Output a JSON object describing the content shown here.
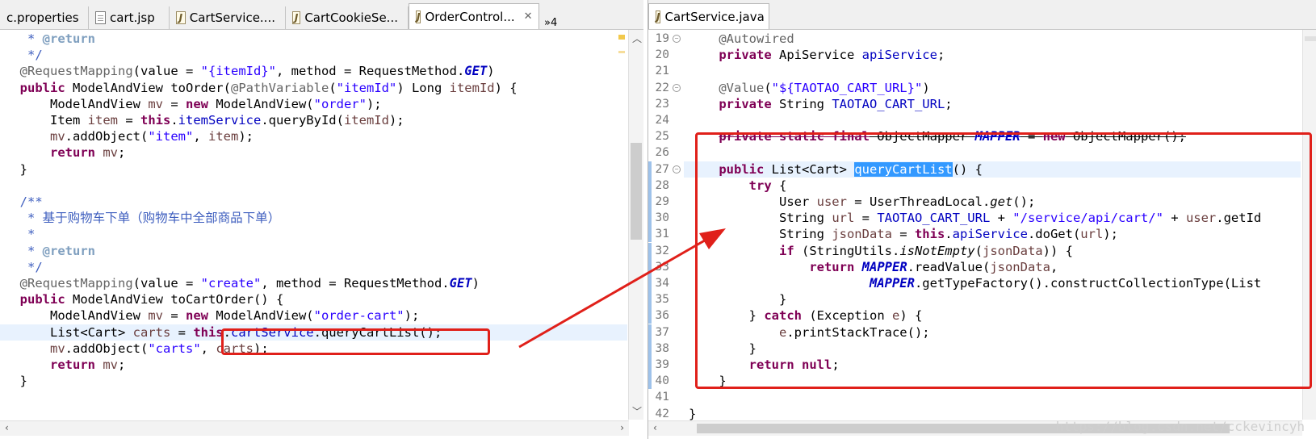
{
  "left_editor": {
    "tabs": [
      {
        "label": "c.properties",
        "icon": "properties-file-icon",
        "active": false
      },
      {
        "label": "cart.jsp",
        "icon": "jsp-file-icon",
        "active": false
      },
      {
        "label": "CartService....",
        "icon": "java-file-icon",
        "active": false
      },
      {
        "label": "CartCookieSe...",
        "icon": "java-file-icon",
        "active": false
      },
      {
        "label": "OrderControl...",
        "icon": "java-file-icon",
        "active": true
      }
    ],
    "overflow_label": "»4",
    "close_glyph": "✕",
    "lines": [
      [
        {
          "t": "   * ",
          "c": "cm"
        },
        {
          "t": "@return",
          "c": "tag"
        }
      ],
      [
        {
          "t": "   */",
          "c": "cm"
        }
      ],
      [
        {
          "t": "  ",
          "c": ""
        },
        {
          "t": "@RequestMapping",
          "c": "ann"
        },
        {
          "t": "(value = ",
          "c": ""
        },
        {
          "t": "\"{itemId}\"",
          "c": "str"
        },
        {
          "t": ", method = RequestMethod.",
          "c": ""
        },
        {
          "t": "GET",
          "c": "sfld"
        },
        {
          "t": ")",
          "c": ""
        }
      ],
      [
        {
          "t": "  ",
          "c": ""
        },
        {
          "t": "public",
          "c": "kw"
        },
        {
          "t": " ModelAndView toOrder(",
          "c": ""
        },
        {
          "t": "@PathVariable",
          "c": "ann"
        },
        {
          "t": "(",
          "c": ""
        },
        {
          "t": "\"itemId\"",
          "c": "str"
        },
        {
          "t": ") Long ",
          "c": ""
        },
        {
          "t": "itemId",
          "c": "var"
        },
        {
          "t": ") {",
          "c": ""
        }
      ],
      [
        {
          "t": "      ModelAndView ",
          "c": ""
        },
        {
          "t": "mv",
          "c": "var"
        },
        {
          "t": " = ",
          "c": ""
        },
        {
          "t": "new",
          "c": "kw"
        },
        {
          "t": " ModelAndView(",
          "c": ""
        },
        {
          "t": "\"order\"",
          "c": "str"
        },
        {
          "t": ");",
          "c": ""
        }
      ],
      [
        {
          "t": "      Item ",
          "c": ""
        },
        {
          "t": "item",
          "c": "var"
        },
        {
          "t": " = ",
          "c": ""
        },
        {
          "t": "this",
          "c": "kw"
        },
        {
          "t": ".",
          "c": ""
        },
        {
          "t": "itemService",
          "c": "fld"
        },
        {
          "t": ".queryById(",
          "c": ""
        },
        {
          "t": "itemId",
          "c": "var"
        },
        {
          "t": ");",
          "c": ""
        }
      ],
      [
        {
          "t": "      ",
          "c": ""
        },
        {
          "t": "mv",
          "c": "var"
        },
        {
          "t": ".addObject(",
          "c": ""
        },
        {
          "t": "\"item\"",
          "c": "str"
        },
        {
          "t": ", ",
          "c": ""
        },
        {
          "t": "item",
          "c": "var"
        },
        {
          "t": ");",
          "c": ""
        }
      ],
      [
        {
          "t": "      ",
          "c": ""
        },
        {
          "t": "return",
          "c": "kw"
        },
        {
          "t": " ",
          "c": ""
        },
        {
          "t": "mv",
          "c": "var"
        },
        {
          "t": ";",
          "c": ""
        }
      ],
      [
        {
          "t": "  }",
          "c": ""
        }
      ],
      [
        {
          "t": "",
          "c": ""
        }
      ],
      [
        {
          "t": "  /**",
          "c": "cm"
        }
      ],
      [
        {
          "t": "   * 基于购物车下单（购物车中全部商品下单）",
          "c": "cm"
        }
      ],
      [
        {
          "t": "   *",
          "c": "cm"
        }
      ],
      [
        {
          "t": "   * ",
          "c": "cm"
        },
        {
          "t": "@return",
          "c": "tag"
        }
      ],
      [
        {
          "t": "   */",
          "c": "cm"
        }
      ],
      [
        {
          "t": "  ",
          "c": ""
        },
        {
          "t": "@RequestMapping",
          "c": "ann"
        },
        {
          "t": "(value = ",
          "c": ""
        },
        {
          "t": "\"create\"",
          "c": "str"
        },
        {
          "t": ", method = RequestMethod.",
          "c": ""
        },
        {
          "t": "GET",
          "c": "sfld"
        },
        {
          "t": ")",
          "c": ""
        }
      ],
      [
        {
          "t": "  ",
          "c": ""
        },
        {
          "t": "public",
          "c": "kw"
        },
        {
          "t": " ModelAndView toCartOrder() {",
          "c": ""
        }
      ],
      [
        {
          "t": "      ModelAndView ",
          "c": ""
        },
        {
          "t": "mv",
          "c": "var"
        },
        {
          "t": " = ",
          "c": ""
        },
        {
          "t": "new",
          "c": "kw"
        },
        {
          "t": " ModelAndView(",
          "c": ""
        },
        {
          "t": "\"order-cart\"",
          "c": "str"
        },
        {
          "t": ");",
          "c": ""
        }
      ],
      [
        {
          "t": "      List<Cart> ",
          "c": ""
        },
        {
          "t": "carts",
          "c": "var"
        },
        {
          "t": " = ",
          "c": ""
        },
        {
          "t": "this",
          "c": "kw"
        },
        {
          "t": ".",
          "c": ""
        },
        {
          "t": "cartService",
          "c": "fld"
        },
        {
          "t": ".queryCartList();",
          "c": ""
        }
      ],
      [
        {
          "t": "      ",
          "c": ""
        },
        {
          "t": "mv",
          "c": "var"
        },
        {
          "t": ".addObject(",
          "c": ""
        },
        {
          "t": "\"carts\"",
          "c": "str"
        },
        {
          "t": ", ",
          "c": ""
        },
        {
          "t": "carts",
          "c": "var"
        },
        {
          "t": ");",
          "c": ""
        }
      ],
      [
        {
          "t": "      ",
          "c": ""
        },
        {
          "t": "return",
          "c": "kw"
        },
        {
          "t": " ",
          "c": ""
        },
        {
          "t": "mv",
          "c": "var"
        },
        {
          "t": ";",
          "c": ""
        }
      ],
      [
        {
          "t": "  }",
          "c": ""
        }
      ]
    ]
  },
  "right_editor": {
    "tabs": [
      {
        "label": "CartService.java",
        "icon": "java-file-icon",
        "active": true
      }
    ],
    "close_glyph": "✕",
    "line_numbers": [
      "19",
      "20",
      "21",
      "22",
      "23",
      "24",
      "25",
      "26",
      "27",
      "28",
      "29",
      "30",
      "31",
      "32",
      "33",
      "34",
      "35",
      "36",
      "37",
      "38",
      "39",
      "40",
      "41",
      "42"
    ],
    "lines": [
      [
        {
          "t": "    ",
          "c": ""
        },
        {
          "t": "@Autowired",
          "c": "ann"
        }
      ],
      [
        {
          "t": "    ",
          "c": ""
        },
        {
          "t": "private",
          "c": "kw"
        },
        {
          "t": " ApiService ",
          "c": ""
        },
        {
          "t": "apiService",
          "c": "fld"
        },
        {
          "t": ";",
          "c": ""
        }
      ],
      [
        {
          "t": "",
          "c": ""
        }
      ],
      [
        {
          "t": "    ",
          "c": ""
        },
        {
          "t": "@Value",
          "c": "ann"
        },
        {
          "t": "(",
          "c": ""
        },
        {
          "t": "\"${TAOTAO_CART_URL}\"",
          "c": "str"
        },
        {
          "t": ")",
          "c": ""
        }
      ],
      [
        {
          "t": "    ",
          "c": ""
        },
        {
          "t": "private",
          "c": "kw"
        },
        {
          "t": " String ",
          "c": ""
        },
        {
          "t": "TAOTAO_CART_URL",
          "c": "fld"
        },
        {
          "t": ";",
          "c": ""
        }
      ],
      [
        {
          "t": "",
          "c": ""
        }
      ],
      [
        {
          "t": "    ",
          "c": ""
        },
        {
          "t": "private static final",
          "c": "kw strike"
        },
        {
          "t": " ObjectMapper ",
          "c": "strike"
        },
        {
          "t": "MAPPER",
          "c": "sfld strike"
        },
        {
          "t": " = ",
          "c": "strike"
        },
        {
          "t": "new",
          "c": "kw strike"
        },
        {
          "t": " ObjectMapper();",
          "c": "strike"
        }
      ],
      [
        {
          "t": "",
          "c": ""
        }
      ],
      [
        {
          "t": "    ",
          "c": ""
        },
        {
          "t": "public",
          "c": "kw"
        },
        {
          "t": " List<Cart> ",
          "c": ""
        },
        {
          "t": "queryCartList",
          "c": "sel"
        },
        {
          "t": "() {",
          "c": ""
        }
      ],
      [
        {
          "t": "        ",
          "c": ""
        },
        {
          "t": "try",
          "c": "kw"
        },
        {
          "t": " {",
          "c": ""
        }
      ],
      [
        {
          "t": "            User ",
          "c": ""
        },
        {
          "t": "user",
          "c": "var"
        },
        {
          "t": " = UserThreadLocal.",
          "c": ""
        },
        {
          "t": "get",
          "c": "ital"
        },
        {
          "t": "();",
          "c": ""
        }
      ],
      [
        {
          "t": "            String ",
          "c": ""
        },
        {
          "t": "url",
          "c": "var"
        },
        {
          "t": " = ",
          "c": ""
        },
        {
          "t": "TAOTAO_CART_URL",
          "c": "fld"
        },
        {
          "t": " + ",
          "c": ""
        },
        {
          "t": "\"/service/api/cart/\"",
          "c": "str"
        },
        {
          "t": " + ",
          "c": ""
        },
        {
          "t": "user",
          "c": "var"
        },
        {
          "t": ".getId",
          "c": ""
        }
      ],
      [
        {
          "t": "            String ",
          "c": ""
        },
        {
          "t": "jsonData",
          "c": "var"
        },
        {
          "t": " = ",
          "c": ""
        },
        {
          "t": "this",
          "c": "kw"
        },
        {
          "t": ".",
          "c": ""
        },
        {
          "t": "apiService",
          "c": "fld"
        },
        {
          "t": ".doGet(",
          "c": ""
        },
        {
          "t": "url",
          "c": "var"
        },
        {
          "t": ");",
          "c": ""
        }
      ],
      [
        {
          "t": "            ",
          "c": ""
        },
        {
          "t": "if",
          "c": "kw"
        },
        {
          "t": " (StringUtils.",
          "c": ""
        },
        {
          "t": "isNotEmpty",
          "c": "ital"
        },
        {
          "t": "(",
          "c": ""
        },
        {
          "t": "jsonData",
          "c": "var"
        },
        {
          "t": ")) {",
          "c": ""
        }
      ],
      [
        {
          "t": "                ",
          "c": ""
        },
        {
          "t": "return",
          "c": "kw"
        },
        {
          "t": " ",
          "c": ""
        },
        {
          "t": "MAPPER",
          "c": "sfld"
        },
        {
          "t": ".readValue(",
          "c": ""
        },
        {
          "t": "jsonData",
          "c": "var"
        },
        {
          "t": ",",
          "c": ""
        }
      ],
      [
        {
          "t": "                        ",
          "c": ""
        },
        {
          "t": "MAPPER",
          "c": "sfld"
        },
        {
          "t": ".getTypeFactory().constructCollectionType(List",
          "c": ""
        }
      ],
      [
        {
          "t": "            }",
          "c": ""
        }
      ],
      [
        {
          "t": "        } ",
          "c": ""
        },
        {
          "t": "catch",
          "c": "kw"
        },
        {
          "t": " (Exception ",
          "c": ""
        },
        {
          "t": "e",
          "c": "var"
        },
        {
          "t": ") {",
          "c": ""
        }
      ],
      [
        {
          "t": "            ",
          "c": ""
        },
        {
          "t": "e",
          "c": "var"
        },
        {
          "t": ".printStackTrace();",
          "c": ""
        }
      ],
      [
        {
          "t": "        }",
          "c": ""
        }
      ],
      [
        {
          "t": "        ",
          "c": ""
        },
        {
          "t": "return",
          "c": "kw"
        },
        {
          "t": " ",
          "c": ""
        },
        {
          "t": "null",
          "c": "kw"
        },
        {
          "t": ";",
          "c": ""
        }
      ],
      [
        {
          "t": "    }",
          "c": ""
        }
      ],
      [
        {
          "t": "",
          "c": ""
        }
      ],
      [
        {
          "t": "}",
          "c": ""
        }
      ]
    ]
  },
  "watermark": "https://blog.csdn.net/cckevincyh",
  "colors": {
    "highlight_box": "#e0201a",
    "selection": "#3399ff",
    "current_line": "#e8f2fe"
  }
}
